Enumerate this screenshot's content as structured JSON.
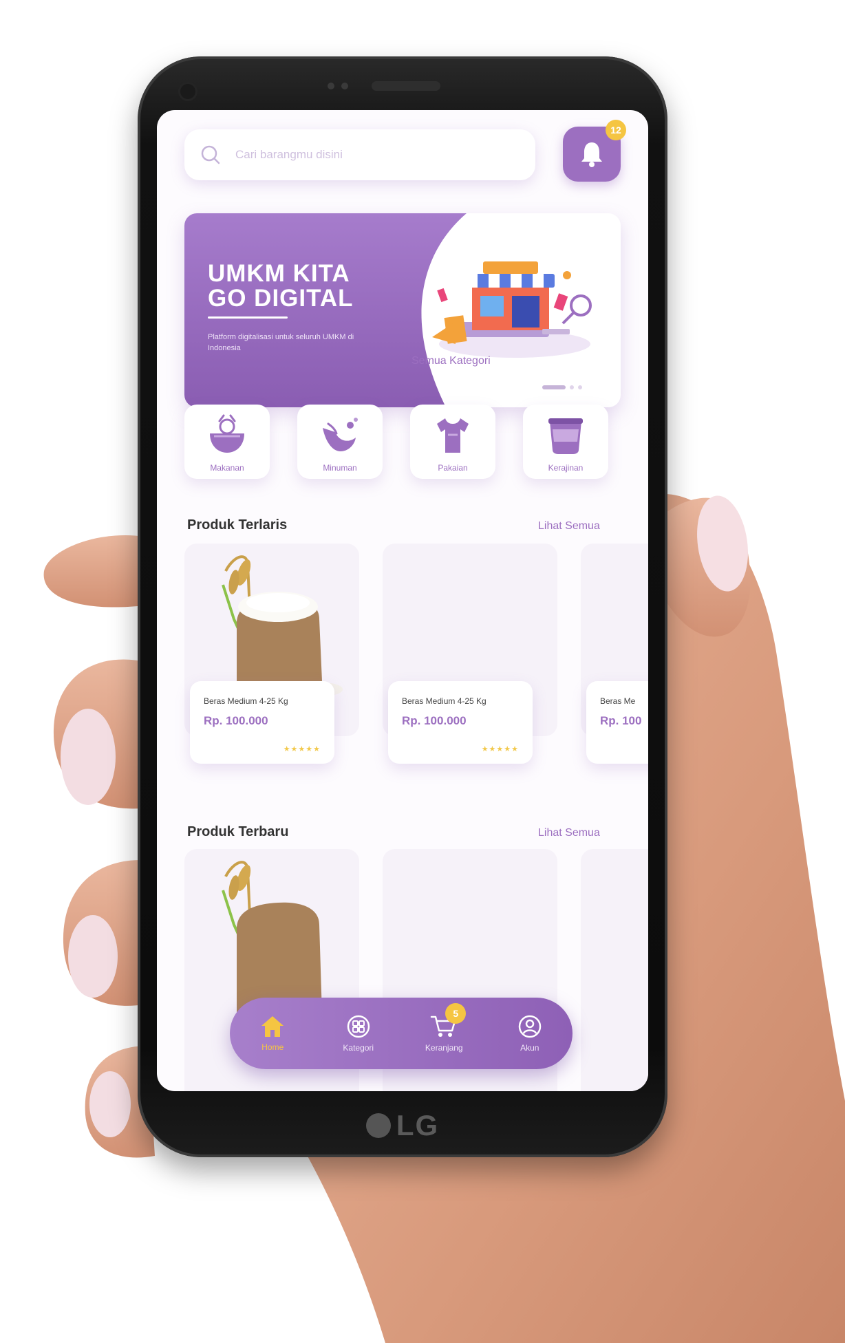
{
  "device": {
    "brand": "LG"
  },
  "header": {
    "search_placeholder": "Cari barangmu disini",
    "notification_count": "12"
  },
  "banner": {
    "title_line1": "UMKM KITA",
    "title_line2": "GO DIGITAL",
    "subtitle": "Platform digitalisasi untuk seluruh UMKM di Indonesia"
  },
  "categories": {
    "see_all": "Semua Kategori",
    "items": [
      {
        "label": "Makanan",
        "icon": "food-bowl-icon"
      },
      {
        "label": "Minuman",
        "icon": "drink-splash-icon"
      },
      {
        "label": "Pakaian",
        "icon": "shirt-icon"
      },
      {
        "label": "Kerajinan",
        "icon": "craft-pot-icon"
      }
    ]
  },
  "popular": {
    "title": "Produk Terlaris",
    "see_all": "Lihat Semua",
    "products": [
      {
        "name": "Beras Medium 4-25 Kg",
        "price": "Rp. 100.000",
        "rating": "★★★★★"
      },
      {
        "name": "Beras Medium 4-25 Kg",
        "price": "Rp. 100.000",
        "rating": "★★★★★"
      },
      {
        "name": "Beras Me",
        "price": "Rp. 100",
        "rating": ""
      }
    ]
  },
  "newest": {
    "title": "Produk Terbaru",
    "see_all": "Lihat Semua"
  },
  "bottom_nav": {
    "items": [
      {
        "label": "Home",
        "icon": "home-icon",
        "active": true
      },
      {
        "label": "Kategori",
        "icon": "grid-icon"
      },
      {
        "label": "Keranjang",
        "icon": "cart-icon",
        "badge": "5"
      },
      {
        "label": "Akun",
        "icon": "user-icon"
      }
    ]
  },
  "colors": {
    "primary": "#9c6fc0",
    "accent": "#f5c542",
    "background": "#fdfbfe"
  }
}
